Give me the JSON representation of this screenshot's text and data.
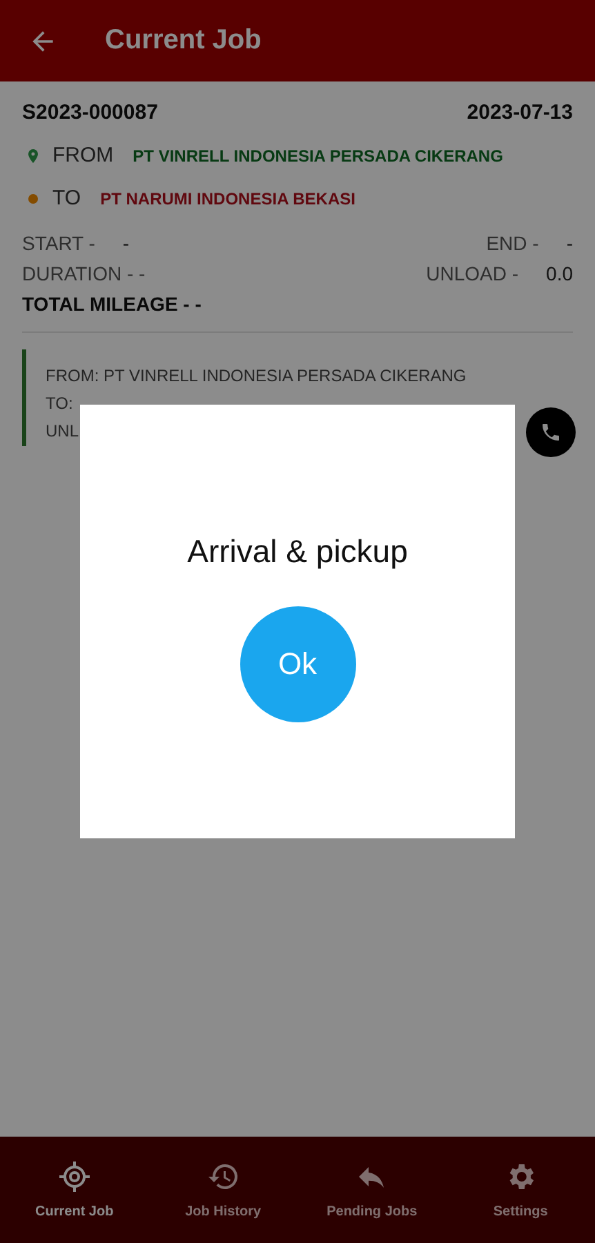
{
  "header": {
    "title": "Current Job"
  },
  "job": {
    "number": "S2023-000087",
    "date": "2023-07-13",
    "from_label": "FROM",
    "from": "PT VINRELL INDONESIA PERSADA CIKERANG",
    "to_label": "TO",
    "to": "PT NARUMI INDONESIA BEKASI",
    "start": "START -",
    "start_value": "-",
    "end": "END -",
    "end_value": "-",
    "duration": "DURATION - -",
    "unload": "UNLOAD -",
    "unload_value": "0.0",
    "total_mileage": "TOTAL MILEAGE - -"
  },
  "stop_card": {
    "lines": [
      "FROM: PT VINRELL INDONESIA PERSADA CIKERANG",
      "TO:",
      "UNL"
    ]
  },
  "dialog": {
    "title": "Arrival & pickup",
    "button": "Ok"
  },
  "nav": [
    {
      "kind": "target",
      "label": "Current Job",
      "selected": true
    },
    {
      "kind": "history",
      "label": "Job History",
      "selected": false
    },
    {
      "kind": "reply",
      "label": "Pending Jobs",
      "selected": false
    },
    {
      "kind": "gear",
      "label": "Settings",
      "selected": false
    }
  ]
}
